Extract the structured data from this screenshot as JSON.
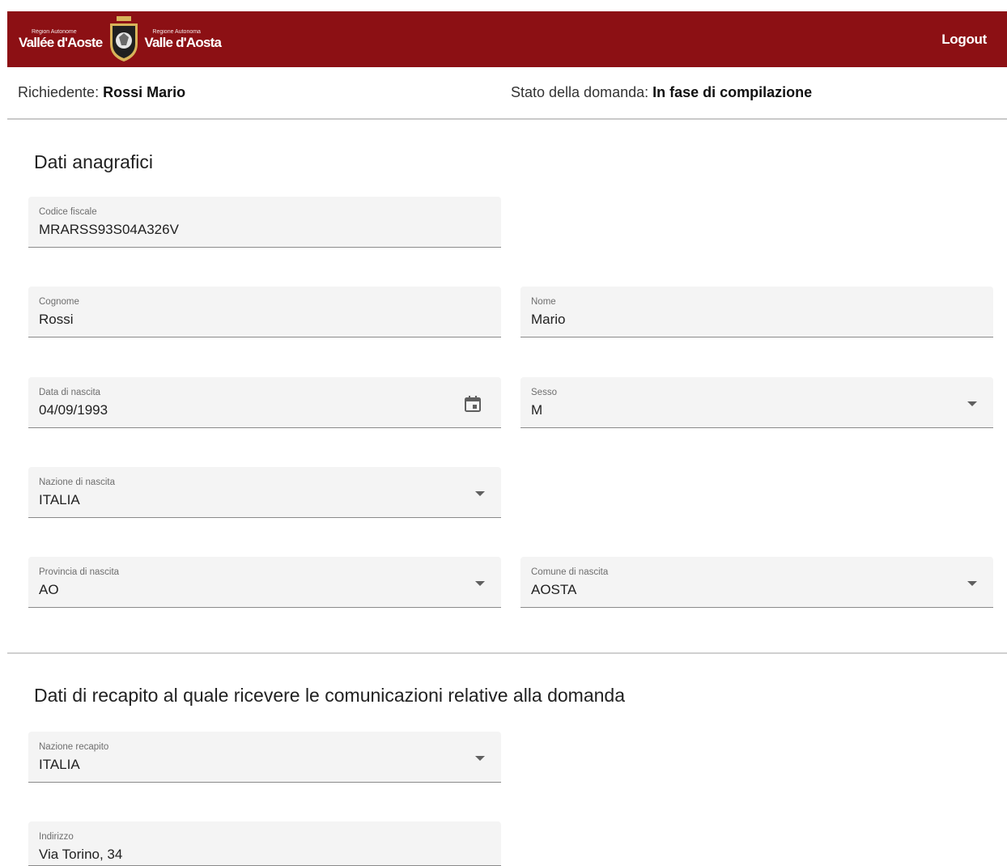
{
  "header": {
    "logo_left_small": "Région Autonome",
    "logo_left_big": "Vallée d'Aoste",
    "logo_right_small": "Regione Autonoma",
    "logo_right_big": "Valle d'Aosta",
    "logout_label": "Logout",
    "bg_color": "#8c1014"
  },
  "info": {
    "applicant_label": "Richiedente:",
    "applicant_value": "Rossi Mario",
    "status_label": "Stato della domanda:",
    "status_value": "In fase di compilazione"
  },
  "anagrafici": {
    "title": "Dati anagrafici",
    "codice_fiscale": {
      "label": "Codice fiscale",
      "value": "MRARSS93S04A326V"
    },
    "cognome": {
      "label": "Cognome",
      "value": "Rossi"
    },
    "nome": {
      "label": "Nome",
      "value": "Mario"
    },
    "data_nascita": {
      "label": "Data di nascita",
      "value": "04/09/1993",
      "icon": "calendar-icon"
    },
    "sesso": {
      "label": "Sesso",
      "value": "M"
    },
    "nazione_nascita": {
      "label": "Nazione di nascita",
      "value": "ITALIA"
    },
    "provincia_nascita": {
      "label": "Provincia di nascita",
      "value": "AO"
    },
    "comune_nascita": {
      "label": "Comune di nascita",
      "value": "AOSTA"
    }
  },
  "recapito": {
    "title": "Dati di recapito al quale ricevere le comunicazioni relative alla domanda",
    "nazione": {
      "label": "Nazione recapito",
      "value": "ITALIA"
    },
    "indirizzo": {
      "label": "Indirizzo",
      "value": "Via Torino, 34"
    }
  }
}
